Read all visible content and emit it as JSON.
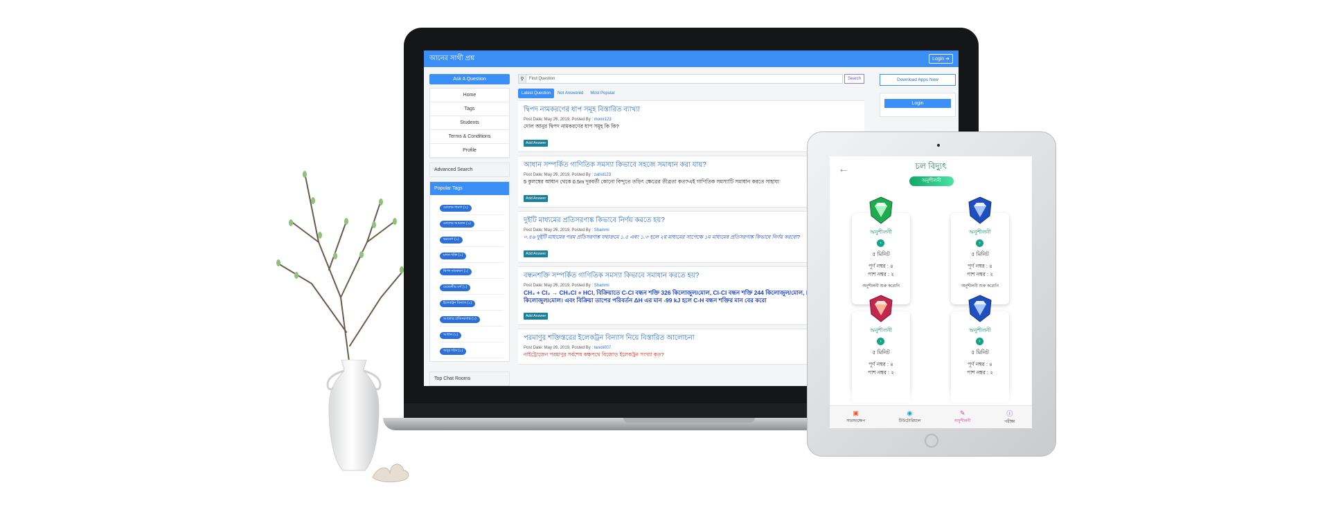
{
  "laptop_app": {
    "title": "আনের সাথী প্রশ্ন",
    "login_top": "Login ➔",
    "ask_button": "Ask A Question",
    "nav": [
      "Home",
      "Tags",
      "Students",
      "Terms & Conditions",
      "Profile"
    ],
    "advanced_search": "Advanced Search",
    "popular_tags_title": "Popular Tags",
    "popular_tags": [
      "মোলের ধারণা (২)",
      "মোলের আয়তন (১)",
      "ভরবেগ (১)",
      "মন্দন শক্তি (১)",
      "দ্বিপদ নামকরণ (১)",
      "মেন্ডেলীয় বর্গ (১)",
      "ইলেকট্রন বিন্যাস (১)",
      "আলোর প্রতিসরণাঙ্ক (১)",
      "আধান (১)",
      "অণুর গঠন (১)"
    ],
    "top_chat_rooms": "Top Chat Rooms",
    "search_placeholder": "Find Question",
    "search_button": "Search",
    "tabs": [
      "Latest Question",
      "Not Answered",
      "Most Popular"
    ],
    "download_button": "Download Apps Now",
    "login_button": "Login",
    "add_answer_label": "Add Answer",
    "questions": [
      {
        "title": "দ্বিপদ নামকরণের ধাপ সমূহ বিস্তারিত ব্যাখ্যা",
        "meta": "Post Date: May 26, 2019, Posted By :",
        "author": "monir123",
        "body": "দোল আনুর দ্বিপদ নামকরণের ধাপ সমূহ কি কি?"
      },
      {
        "title": "আধান সম্পর্কিত গাণিতিক সমস্যা কিভাবে সহজে সমাধান করা যায়?",
        "meta": "Post Date: May 26, 2019, Posted By :",
        "author": "zahid123",
        "body": "5 কুলম্বের আধান থেকে 0.5m দূরবর্তী কোনো বিন্দুতে তড়িৎ ক্ষেত্রের তীব্রতা কত?এই গাণিতিক সমস্যাটি সমাধান করতে সাহায্য"
      },
      {
        "title": "দুইটি মাধ্যমের প্রতিসরণাঙ্ক কিভাবে নির্ণয় করতে হয়?",
        "meta": "Post Date: May 26, 2019, Posted By :",
        "author": "Shammi",
        "body": "০.৫৬ দুইটি মাধ্যমের পরম প্রতিসরণাঙ্ক যথাক্রমে ১.৫ এবং ১.৩ হলে ২য় মাধ্যমের সাপেক্ষে ১ম মাধ্যমের প্রতিসরণাঙ্ক কিভাবে নির্ণয় করবো?"
      },
      {
        "title": "বন্ধনশক্তি সম্পর্কিত গাণিতিক সমস্যা কিভাবে সমাধান করতে হয়?",
        "meta": "Post Date: May 26, 2019, Posted By :",
        "author": "Shammi",
        "body": "CH₄ + Cl₂ → CH₃Cl + HCl, বিক্রিয়াতে C-Cl বন্ধন শক্তি 326 কিলোজুল/মোল, Cl-Cl বন্ধন শক্তি 244 কিলোজুল/মোল, H-Cl বন্ধন শক্তি 431 কিলোজুল/মোল। এবং বিক্রিয়া তাপের পরিবর্তন ΔH এর মান -99 kJ হলে C-H বন্ধন শক্তির মান বের করো"
      },
      {
        "title": "পরমাণুর শক্তিস্তরের ইলেকট্রন বিন্যাস নিয়ে বিস্তারিত আলোচনা",
        "meta": "Post Date: May 26, 2019, Posted By :",
        "author": "tanoli007",
        "body": "নাইট্রোজেন পরমাণুর সর্বশেষ কক্ষপথে বিজোড় ইলেকট্রন সংখ্যা কত?"
      }
    ]
  },
  "tablet_app": {
    "title": "চল বিদ্যুৎ",
    "pill": "অনুশীলনী",
    "cards": [
      {
        "level": "অনুশীলনী",
        "minutes": "৫ মিনিট",
        "full": "পূর্ণ নম্বর : ৪",
        "pass": "পাশ নম্বর : ২",
        "start": "অনুশীলনী শুরু করোনি",
        "color": "#1faa4f"
      },
      {
        "level": "অনুশীলনী",
        "minutes": "৫ মিনিট",
        "full": "পূর্ণ নম্বর : ৪",
        "pass": "পাশ নম্বর : ২",
        "start": "অনুশীলনী শুরু করোনি",
        "color": "#1f4fbf"
      },
      {
        "level": "অনুশীলনী",
        "minutes": "৫ মিনিট",
        "full": "পূর্ণ নম্বর : ৪",
        "pass": "পাশ নম্বর : ২",
        "start": "",
        "color": "#c2274f"
      },
      {
        "level": "অনুশীলনী",
        "minutes": "৫ মিনিট",
        "full": "পূর্ণ নম্বর : ৪",
        "pass": "পাশ নম্বর : ২",
        "start": "",
        "color": "#1f4fbf"
      }
    ],
    "bottom_nav": [
      {
        "label": "সারসংক্ষেপ",
        "icon": "summary-icon"
      },
      {
        "label": "টিউটোরিয়াল",
        "icon": "tutorial-icon"
      },
      {
        "label": "অনুশীলনী",
        "icon": "practice-icon"
      },
      {
        "label": "পরীক্ষা",
        "icon": "exam-icon"
      }
    ]
  }
}
